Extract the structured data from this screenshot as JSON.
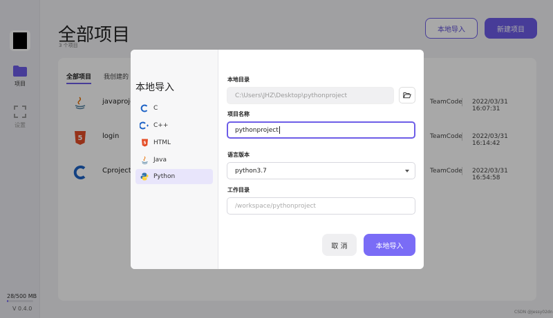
{
  "sidebar": {
    "items": [
      {
        "label": "项目",
        "icon": "folder-icon"
      },
      {
        "label": "设置",
        "icon": "settings-icon"
      }
    ],
    "storage": "28/500 MB",
    "storage_fraction": 0.056,
    "version": "V 0.4.0"
  },
  "header": {
    "title": "全部项目",
    "subtitle": "3 个项目",
    "local_import_label": "本地导入",
    "new_project_label": "新建项目"
  },
  "tabs": [
    "全部项目",
    "我创建的"
  ],
  "projects": [
    {
      "name": "javaproject",
      "icon": "java-icon",
      "owner": "TeamCode",
      "time": "2022/03/31 16:07:31"
    },
    {
      "name": "login",
      "icon": "html5-icon",
      "owner": "TeamCode",
      "time": "2022/03/31 16:14:42"
    },
    {
      "name": "Cproject",
      "icon": "c-lang-icon",
      "owner": "TeamCode",
      "time": "2022/03/31 16:54:58"
    }
  ],
  "modal": {
    "title": "本地导入",
    "languages": [
      {
        "label": "C",
        "icon": "c-lang-icon"
      },
      {
        "label": "C++",
        "icon": "cpp-lang-icon"
      },
      {
        "label": "HTML",
        "icon": "html5-icon"
      },
      {
        "label": "Java",
        "icon": "java-icon"
      },
      {
        "label": "Python",
        "icon": "python-icon",
        "selected": true
      }
    ],
    "local_dir_label": "本地目录",
    "local_dir_value": "C:\\Users\\JHZ\\Desktop\\pythonproject",
    "project_name_label": "项目名称",
    "project_name_value": "pythonproject",
    "language_version_label": "语言版本",
    "language_version_value": "python3.7",
    "work_dir_label": "工作目录",
    "work_dir_placeholder": "/workspace/pythonproject",
    "cancel_label": "取 消",
    "import_label": "本地导入"
  },
  "watermark": "CSDN @Jessy02dn",
  "colors": {
    "accent": "#6c5ce7"
  }
}
